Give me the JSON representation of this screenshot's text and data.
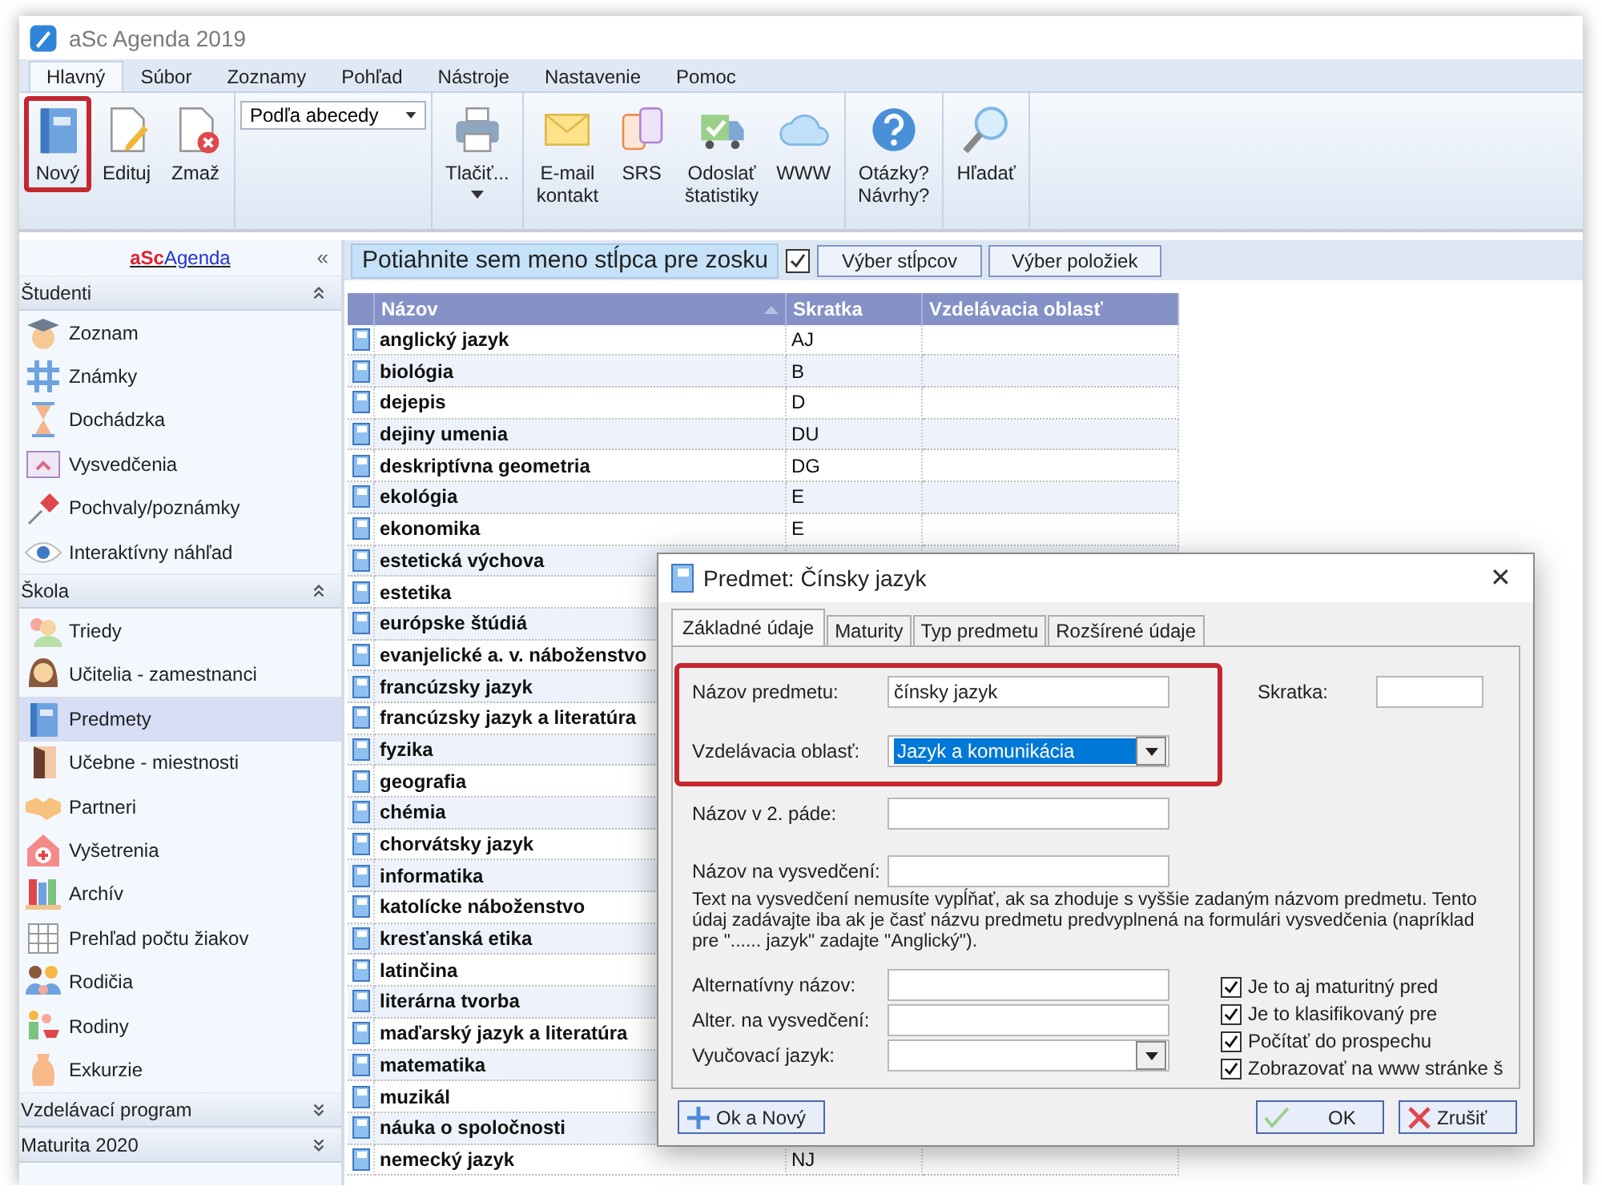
{
  "window": {
    "title": "aSc Agenda 2019"
  },
  "menu_tabs": [
    {
      "label": "Hlavný",
      "selected": true
    },
    {
      "label": "Súbor",
      "selected": false
    },
    {
      "label": "Zoznamy",
      "selected": false
    },
    {
      "label": "Pohľad",
      "selected": false
    },
    {
      "label": "Nástroje",
      "selected": false
    },
    {
      "label": "Nastavenie",
      "selected": false
    },
    {
      "label": "Pomoc",
      "selected": false
    }
  ],
  "ribbon": {
    "groups": [
      {
        "kind": "buttons",
        "buttons": [
          {
            "label": "Nový",
            "highlighted": true,
            "menu": false
          },
          {
            "label": "Edituj",
            "highlighted": false,
            "menu": false
          },
          {
            "label": "Zmaž",
            "highlighted": false,
            "menu": false
          }
        ]
      },
      {
        "kind": "dropdown",
        "value": "Podľa abecedy"
      },
      {
        "kind": "buttons",
        "buttons": [
          {
            "label": "Tlačiť...",
            "highlighted": false,
            "menu": true
          }
        ]
      },
      {
        "kind": "buttons",
        "buttons": [
          {
            "label": "E-mail\nkontakt",
            "highlighted": false,
            "menu": false
          },
          {
            "label": "SRS",
            "highlighted": false,
            "menu": false
          },
          {
            "label": "Odoslať\nštatistiky",
            "highlighted": false,
            "menu": false
          },
          {
            "label": "WWW",
            "highlighted": false,
            "menu": false
          }
        ]
      },
      {
        "kind": "buttons",
        "buttons": [
          {
            "label": "Otázky?\nNávrhy?",
            "highlighted": false,
            "menu": false
          }
        ]
      },
      {
        "kind": "buttons",
        "buttons": [
          {
            "label": "Hľadať",
            "highlighted": false,
            "menu": false
          }
        ]
      }
    ]
  },
  "sidebar": {
    "brand": {
      "part_1": "aSc",
      "part_2": "Agenda"
    },
    "collapse_glyph": "«",
    "sections": [
      {
        "title": "Študenti",
        "expanded": true,
        "items": [
          {
            "label": "Zoznam",
            "selected": false
          },
          {
            "label": "Známky",
            "selected": false
          },
          {
            "label": "Dochádzka",
            "selected": false
          },
          {
            "label": "Vysvedčenia",
            "selected": false
          },
          {
            "label": "Pochvaly/poznámky",
            "selected": false
          },
          {
            "label": "Interaktívny náhľad",
            "selected": false
          }
        ]
      },
      {
        "title": "Škola",
        "expanded": true,
        "items": [
          {
            "label": "Triedy",
            "selected": false
          },
          {
            "label": "Učitelia - zamestnanci",
            "selected": false
          },
          {
            "label": "Predmety",
            "selected": true
          },
          {
            "label": "Učebne - miestnosti",
            "selected": false
          },
          {
            "label": "Partneri",
            "selected": false
          },
          {
            "label": "Vyšetrenia",
            "selected": false
          },
          {
            "label": "Archív",
            "selected": false
          },
          {
            "label": "Prehľad počtu žiakov",
            "selected": false
          },
          {
            "label": "Rodičia",
            "selected": false
          },
          {
            "label": "Rodiny",
            "selected": false
          },
          {
            "label": "Exkurzie",
            "selected": false
          }
        ]
      },
      {
        "title": "Vzdelávací program",
        "expanded": false
      },
      {
        "title": "Maturita 2020",
        "expanded": false
      }
    ]
  },
  "grid": {
    "group_hint": "Potiahnite sem meno stĺpca pre zosku",
    "buttons": [
      "Výber stĺpcov",
      "Výber položiek"
    ],
    "columns": [
      {
        "label": "Názov",
        "sorted": true
      },
      {
        "label": "Skratka",
        "sorted": false
      },
      {
        "label": "Vzdelávacia oblasť",
        "sorted": false
      }
    ],
    "rows": [
      {
        "name": "anglický jazyk",
        "code": "AJ"
      },
      {
        "name": "biológia",
        "code": "B"
      },
      {
        "name": "dejepis",
        "code": "D"
      },
      {
        "name": "dejiny umenia",
        "code": "DU"
      },
      {
        "name": "deskriptívna geometria",
        "code": "DG"
      },
      {
        "name": "ekológia",
        "code": "E"
      },
      {
        "name": "ekonomika",
        "code": "E"
      },
      {
        "name": "estetická výchova"
      },
      {
        "name": "estetika"
      },
      {
        "name": "európske štúdiá"
      },
      {
        "name": "evanjelické a. v. náboženstvo"
      },
      {
        "name": "francúzsky jazyk"
      },
      {
        "name": "francúzsky jazyk a literatúra"
      },
      {
        "name": "fyzika"
      },
      {
        "name": "geografia"
      },
      {
        "name": "chémia"
      },
      {
        "name": "chorvátsky jazyk"
      },
      {
        "name": "informatika"
      },
      {
        "name": "katolícke náboženstvo"
      },
      {
        "name": "kresťanská etika"
      },
      {
        "name": "latinčina"
      },
      {
        "name": "literárna tvorba"
      },
      {
        "name": "maďarský jazyk a literatúra"
      },
      {
        "name": "matematika"
      },
      {
        "name": "muzikál"
      },
      {
        "name": "náuka o spoločnosti"
      },
      {
        "name": "nemecký jazyk",
        "code": "NJ"
      }
    ]
  },
  "dialog": {
    "title": "Predmet: Čínsky jazyk",
    "close_glyph": "✕",
    "tabs": [
      {
        "label": "Základné údaje",
        "selected": true
      },
      {
        "label": "Maturity",
        "selected": false
      },
      {
        "label": "Typ predmetu",
        "selected": false
      },
      {
        "label": "Rozšírené údaje",
        "selected": false
      }
    ],
    "fields": [
      {
        "kind": "text",
        "label": "Názov predmetu:",
        "value": "čínsky jazyk",
        "highlighted": true,
        "focused": false
      },
      {
        "kind": "select",
        "label": "Vzdelávacia oblasť:",
        "value": "Jazyk a komunikácia",
        "highlighted": true,
        "focused": true
      },
      {
        "kind": "text",
        "label": "Názov v 2. páde:",
        "highlighted": false,
        "focused": false
      },
      {
        "kind": "text",
        "label": "Názov na vysvedčení:",
        "highlighted": false,
        "focused": false
      }
    ],
    "short_name_field": {
      "label": "Skratka:"
    },
    "note": "Text na vysvedčení nemusíte vypĺňať, ak sa zhoduje s vyššie zadaným názvom predmetu. Tento údaj zadávajte iba ak je časť názvu predmetu predvyplnená na formulári vysvedčenia (napríklad pre \"...... jazyk\" zadajte \"Anglický\").",
    "extra_fields": [
      {
        "kind": "text",
        "label": "Alternatívny názov:",
        "focused": false
      },
      {
        "kind": "text",
        "label": "Alter. na vysvedčení:",
        "focused": false
      },
      {
        "kind": "select",
        "label": "Vyučovací jazyk:",
        "focused": false
      }
    ],
    "checkboxes": [
      {
        "label": "Je to aj maturitný pred",
        "checked": true
      },
      {
        "label": "Je to klasifikovaný pre",
        "checked": true
      },
      {
        "label": "Počítať do prospechu",
        "checked": true
      },
      {
        "label": "Zobrazovať na www stránke š",
        "checked": true
      }
    ],
    "buttons": [
      {
        "label": "Ok a Nový",
        "kind": "add"
      },
      {
        "label": "OK",
        "kind": "ok"
      },
      {
        "label": "Zrušiť",
        "kind": "cancel"
      }
    ]
  }
}
